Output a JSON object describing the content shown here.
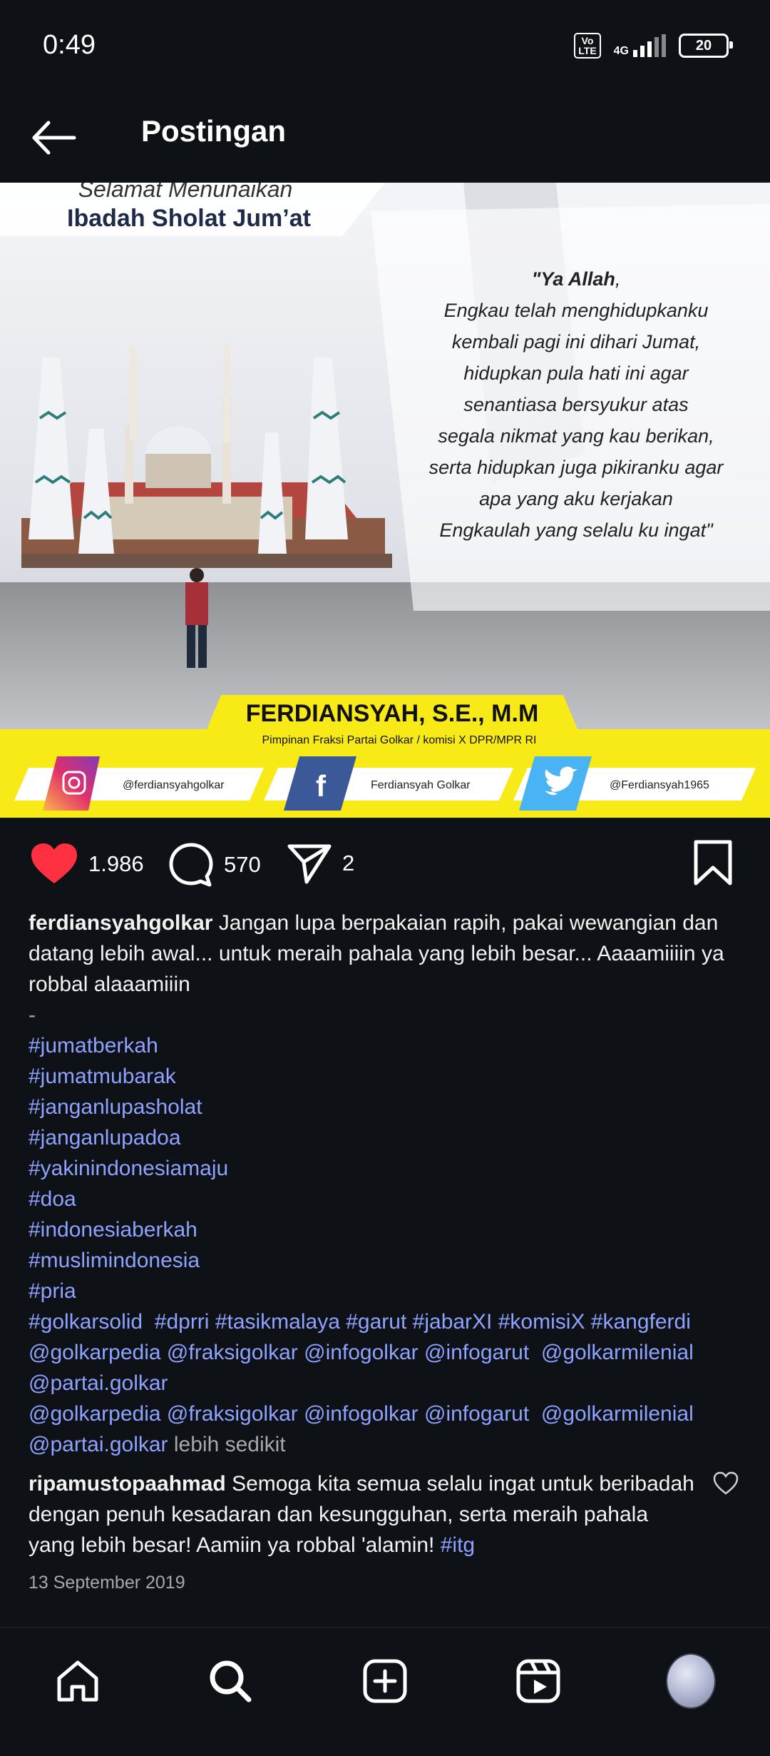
{
  "status_bar": {
    "time": "0:49",
    "volte": "Vo LTE",
    "network": "4G",
    "battery": "20"
  },
  "header": {
    "title": "Postingan"
  },
  "post_image": {
    "banner_line1": "Selamat Menunaikan",
    "banner_line2": "Ibadah Sholat Jum’at",
    "quote_lead": "\"Ya Allah",
    "quote_comma": ",",
    "quote_lines": [
      "Engkau telah menghidupkanku",
      "kembali pagi ini dihari Jumat,",
      "hidupkan pula hati ini agar",
      "senantiasa bersyukur atas",
      "segala nikmat yang kau berikan,",
      "serta hidupkan juga pikiranku agar",
      "apa yang aku kerjakan",
      "Engkaulah yang selalu ku ingat\""
    ],
    "name": "FERDIANSYAH, S.E., M.M",
    "role": "Pimpinan Fraksi Partai Golkar / komisi X DPR/MPR RI",
    "instagram": "@ferdiansyahgolkar",
    "facebook": "Ferdiansyah Golkar",
    "twitter": "@Ferdiansyah1965"
  },
  "actions": {
    "likes": "1.986",
    "comments": "570",
    "shares": "2"
  },
  "caption": {
    "username": "ferdiansyahgolkar",
    "text": " Jangan lupa berpakaian rapih, pakai wewangian dan datang lebih awal... untuk meraih pahala yang lebih besar... Aaaamiiiin ya robbal alaaamiiin",
    "dash": "-",
    "hashtags": [
      "#jumatberkah",
      "#jumatmubarak",
      "#janganlupasholat",
      "#janganlupadoa",
      "#yakinindonesiamaju",
      "#doa",
      "#indonesiaberkah",
      "#muslimindonesia",
      "#pria"
    ],
    "tag_line": [
      "#golkarsolid",
      "#dprri",
      "#tasikmalaya",
      "#garut",
      "#jabarXI",
      "#komisiX",
      "#kangferdi"
    ],
    "mentions1": [
      "@golkarpedia",
      "@fraksigolkar",
      "@infogolkar",
      "@infogarut",
      "@golkarmilenial"
    ],
    "mentions1_end": "@partai.golkar",
    "mentions2": [
      "@golkarpedia",
      "@fraksigolkar",
      "@infogolkar",
      "@infogarut",
      "@golkarmilenial"
    ],
    "mentions2_end": "@partai.golkar",
    "more": "lebih sedikit"
  },
  "comment": {
    "username": "ripamustopaahmad",
    "text": " Semoga kita semua selalu ingat untuk beribadah dengan penuh kesadaran dan kesungguhan, serta meraih pahala yang lebih besar! Aamiin ya robbal 'alamin! ",
    "tag": "#itg"
  },
  "date": "13 September 2019",
  "colors": {
    "like": "#ff3040",
    "link": "#8ea2ff",
    "background": "#0e1116",
    "banner_yellow": "#f7ea17"
  }
}
